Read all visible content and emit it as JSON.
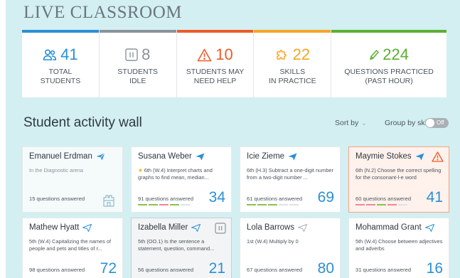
{
  "app_title": "LIVE CLASSROOM",
  "stats": [
    {
      "icon": "students-icon",
      "number": "41",
      "label_line1": "TOTAL",
      "label_line2": "STUDENTS",
      "color": "#2a8fd6"
    },
    {
      "icon": "pause-icon",
      "number": "8",
      "label_line1": "STUDENTS",
      "label_line2": "IDLE",
      "color": "#8a939b"
    },
    {
      "icon": "warning-icon",
      "number": "10",
      "label_line1": "STUDENTS MAY",
      "label_line2": "NEED HELP",
      "color": "#f05a28"
    },
    {
      "icon": "puzzle-icon",
      "number": "22",
      "label_line1": "SKILLS",
      "label_line2": "IN PRACTICE",
      "color": "#f5a623"
    },
    {
      "icon": "pencil-icon",
      "number": "224",
      "label_line1": "QUESTIONS PRACTICED",
      "label_line2": "(PAST HOUR)",
      "color": "#5ab031"
    }
  ],
  "activity": {
    "title": "Student activity wall",
    "sort_label": "Sort by",
    "group_label": "Group by skill:",
    "toggle_label": "Off"
  },
  "cards": [
    {
      "name": "Emanuel Erdman",
      "skill": "In the Diagnostic arena",
      "questions": "15 questions answered",
      "score": ""
    },
    {
      "name": "Susana Weber",
      "skill": "6th (W.4) Interpret charts and graphs to find mean, median...",
      "questions": "91 questions answered",
      "score": "34"
    },
    {
      "name": "Icie Zieme",
      "skill": "6th (H.3) Subtract a one-digit number from a two-digit number ...",
      "questions": "61 questions answered",
      "score": "69"
    },
    {
      "name": "Maymie Stokes",
      "skill": "6th (N.2) Choose the correct spelling for the consonant-l-e word",
      "questions": "60 questions answered",
      "score": "41"
    },
    {
      "name": "Mathew Hyatt",
      "skill": "5th (W.4) Capitalizing the names of people and pets and titles of r...",
      "questions": "98 questions answered",
      "score": "72"
    },
    {
      "name": "Izabella Miller",
      "skill": "5th (OO.1) Is the sentence a statement, question, command...",
      "questions": "56 questions answered",
      "score": "21"
    },
    {
      "name": "Lola Barrows",
      "skill": "1st (W.4) Multiply by 0",
      "questions": "67 questions answered",
      "score": "80"
    },
    {
      "name": "Mohammad Grant",
      "skill": "5th (W.4) Choose between adjectives and adverbs",
      "questions": "31 questions answered",
      "score": "16"
    }
  ]
}
